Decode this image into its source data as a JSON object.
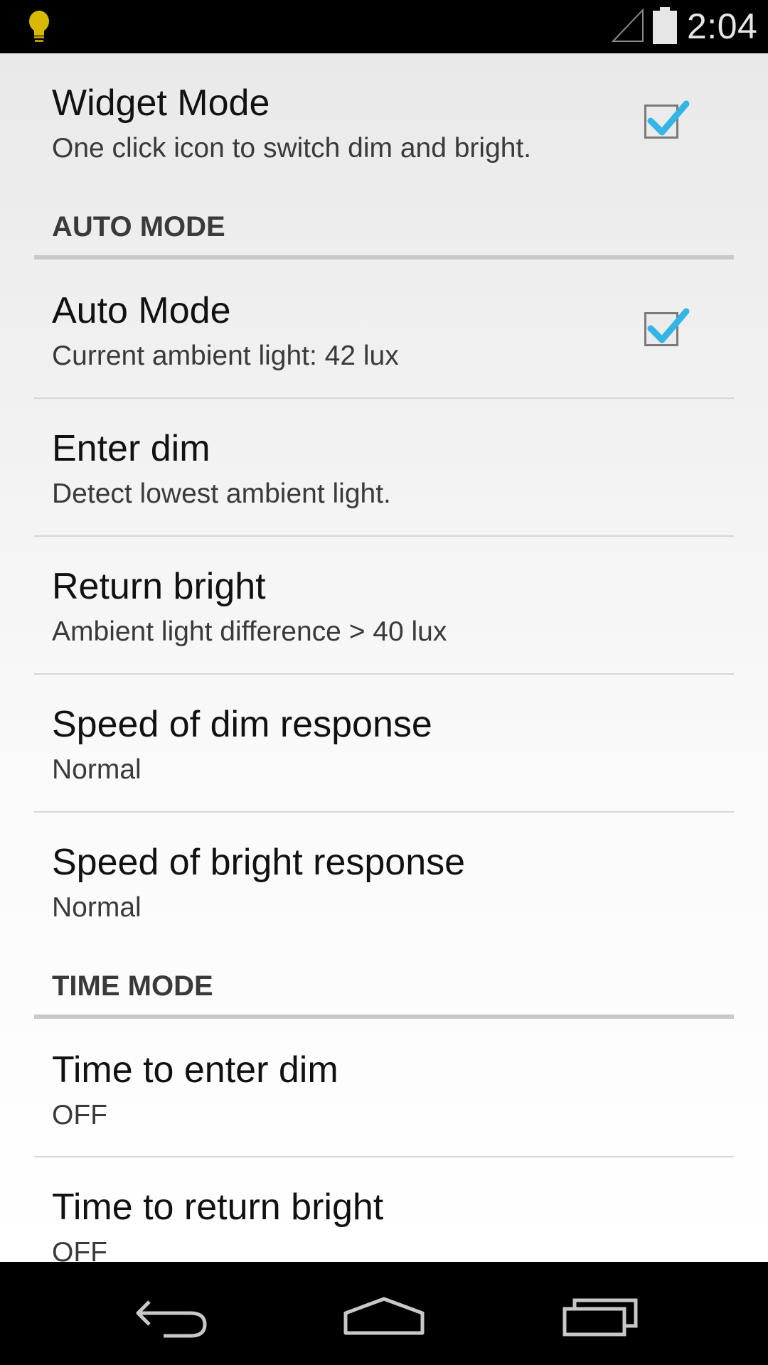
{
  "status_bar": {
    "time": "2:04",
    "icons": [
      "lightbulb-icon",
      "signal-icon",
      "battery-icon"
    ],
    "bulb_color": "#e0c000"
  },
  "preferences": {
    "widget_mode": {
      "title": "Widget Mode",
      "summary": "One click icon to switch dim and bright.",
      "checked": true
    },
    "auto_mode_header": "AUTO MODE",
    "auto_mode": {
      "title": "Auto Mode",
      "summary": "Current ambient light: 42 lux",
      "checked": true
    },
    "enter_dim": {
      "title": "Enter dim",
      "summary": "Detect lowest ambient light."
    },
    "return_bright": {
      "title": "Return bright",
      "summary": "Ambient light difference > 40 lux"
    },
    "speed_dim": {
      "title": "Speed of dim response",
      "summary": "Normal"
    },
    "speed_bright": {
      "title": "Speed of bright response",
      "summary": "Normal"
    },
    "time_mode_header": "TIME MODE",
    "time_enter_dim": {
      "title": "Time to enter dim",
      "summary": "OFF"
    },
    "time_return_bright": {
      "title": "Time to return bright",
      "summary": "OFF"
    }
  },
  "nav_bar": {
    "buttons": [
      "back-icon",
      "home-icon",
      "recents-icon"
    ]
  },
  "colors": {
    "checkmark": "#33b5e5",
    "background_top": "#e9e9e9",
    "background_bottom": "#ffffff"
  }
}
